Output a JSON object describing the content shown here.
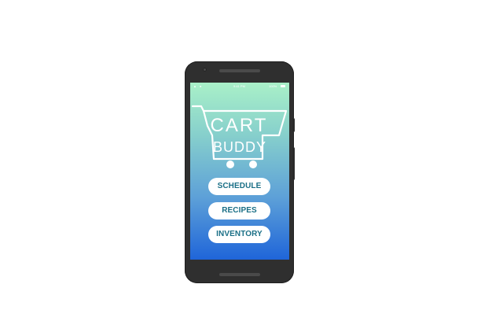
{
  "status_bar": {
    "time": "9:41 PM",
    "battery": "100%"
  },
  "logo": {
    "line1": "CART",
    "line2": "BUDDY"
  },
  "menu": {
    "schedule_label": "SCHEDULE",
    "recipes_label": "RECIPES",
    "inventory_label": "INVENTORY"
  },
  "colors": {
    "gradient_top": "#a9f0c8",
    "gradient_bottom": "#1f65d9",
    "button_text": "#1a6f86",
    "phone_body": "#2f2f2f"
  },
  "icons": [
    "signal-icon",
    "wifi-icon",
    "battery-icon",
    "cart-icon"
  ]
}
